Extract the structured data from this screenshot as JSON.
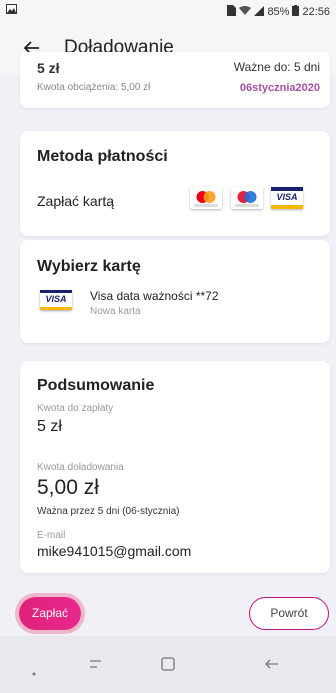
{
  "status_bar": {
    "battery": "85%",
    "time": "22:56"
  },
  "app_bar": {
    "title": "Doładowanie"
  },
  "summary_top": {
    "amount_partial": "5 zł",
    "valid_partial": "Ważne do: 5 dni",
    "charge_label": "Kwota obciążenia: 5,00 zł",
    "date": "06stycznia2020"
  },
  "payment_method": {
    "title": "Metoda płatności",
    "pay_by_card": "Zapłać kartą",
    "brands": [
      "mastercard",
      "maestro",
      "VISA"
    ]
  },
  "choose_card": {
    "title": "Wybierz kartę",
    "card_brand": "VISA",
    "card_name": "Visa data ważności **72",
    "card_sub": "Nowa karta"
  },
  "summary": {
    "title": "Podsumowanie",
    "amount_label": "Kwota do zapłaty",
    "amount_value": "5 zł",
    "topup_label": "Kwota doładowania",
    "topup_value": "5,00 zł",
    "valid_text": "Ważna przez 5 dni (06-stycznia)",
    "email_label": "E-mail",
    "email_value": "mike941015@gmail.com"
  },
  "actions": {
    "pay": "Zapłać",
    "back": "Powrót"
  },
  "colors": {
    "accent": "#e0227a",
    "date": "#a64fa8",
    "background": "#f1f0f7"
  }
}
